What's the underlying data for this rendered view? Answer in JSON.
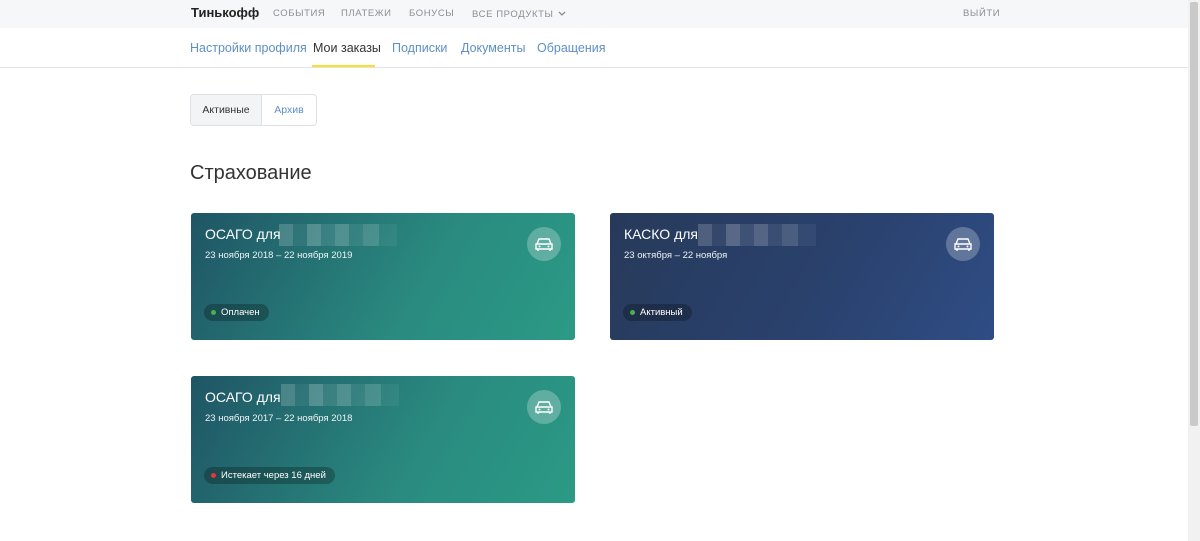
{
  "header": {
    "logo": "Тинькофф",
    "nav": [
      {
        "label": "СОБЫТИЯ"
      },
      {
        "label": "ПЛАТЕЖИ"
      },
      {
        "label": "БОНУСЫ"
      },
      {
        "label": "ВСЕ ПРОДУКТЫ"
      }
    ],
    "logout": "ВЫЙТИ"
  },
  "subnav": {
    "tabs": [
      {
        "label": "Настройки профиля"
      },
      {
        "label": "Мои заказы"
      },
      {
        "label": "Подписки"
      },
      {
        "label": "Документы"
      },
      {
        "label": "Обращения"
      }
    ],
    "active": "Мои заказы"
  },
  "filter": {
    "active_label": "Активные",
    "archive_label": "Архив"
  },
  "section": {
    "title": "Страхование"
  },
  "cards": [
    {
      "title": "ОСАГО для",
      "dates": "23 ноября 2018 – 22 ноября 2019",
      "status": "Оплачен",
      "status_color": "#4caf50",
      "theme_color": "#2a8b80"
    },
    {
      "title": "КАСКО для",
      "dates": "23 октября – 22 ноября",
      "status": "Активный",
      "status_color": "#4caf50",
      "theme_color": "#2a426f"
    },
    {
      "title": "ОСАГО для",
      "dates": "23 ноября 2017 – 22 ноября 2018",
      "status": "Истекает через 16 дней",
      "status_color": "#e53935",
      "theme_color": "#2a8b80"
    }
  ],
  "colors": {
    "accent_underline": "#ffdd2d",
    "link": "#5e8fc4"
  },
  "icons": {
    "card_icon": "car-icon",
    "dropdown_icon": "chevron-down-icon"
  }
}
